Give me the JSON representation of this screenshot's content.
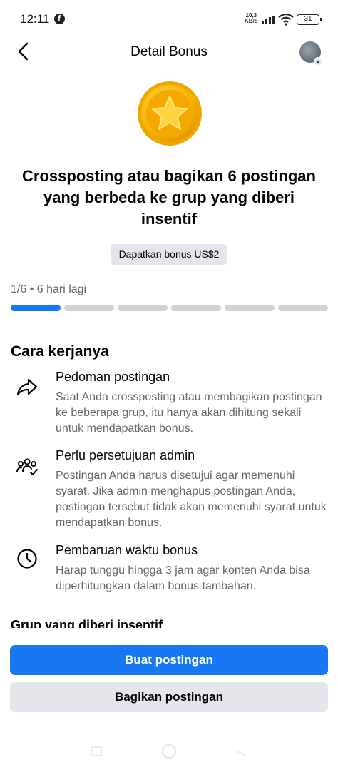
{
  "status_bar": {
    "time": "12:11",
    "net_speed_value": "10,3",
    "net_speed_unit": "KB/d",
    "battery": "31"
  },
  "header": {
    "title": "Detail Bonus"
  },
  "bonus": {
    "title": "Crossposting atau bagikan 6 postingan yang berbeda ke grup yang diberi insentif",
    "chip": "Dapatkan bonus US$2",
    "progress_text": "1/6 • 6 hari lagi",
    "progress": {
      "completed": 1,
      "total": 6
    }
  },
  "how_it_works": {
    "title": "Cara kerjanya",
    "steps": [
      {
        "title": "Pedoman postingan",
        "description": "Saat Anda crossposting atau membagikan postingan ke beberapa grup, itu hanya akan dihitung sekali untuk mendapatkan bonus.",
        "icon": "share-arrow-icon"
      },
      {
        "title": "Perlu persetujuan admin",
        "description": "Postingan Anda harus disetujui agar memenuhi syarat. Jika admin menghapus postingan Anda, postingan tersebut tidak akan memenuhi syarat untuk mendapatkan bonus.",
        "icon": "group-approval-icon"
      },
      {
        "title": "Pembaruan waktu bonus",
        "description": "Harap tunggu hingga 3 jam agar konten Anda bisa diperhitungkan dalam bonus tambahan.",
        "icon": "clock-icon"
      }
    ]
  },
  "groups": {
    "title": "Grup yang diberi insentif"
  },
  "actions": {
    "primary": "Buat postingan",
    "secondary": "Bagikan postingan"
  },
  "colors": {
    "accent": "#1877f2",
    "progress_empty": "#d0d2d6",
    "chip_bg": "#e4e6eb",
    "secondary_text": "#65676b",
    "coin_gold": "#f7b500"
  }
}
